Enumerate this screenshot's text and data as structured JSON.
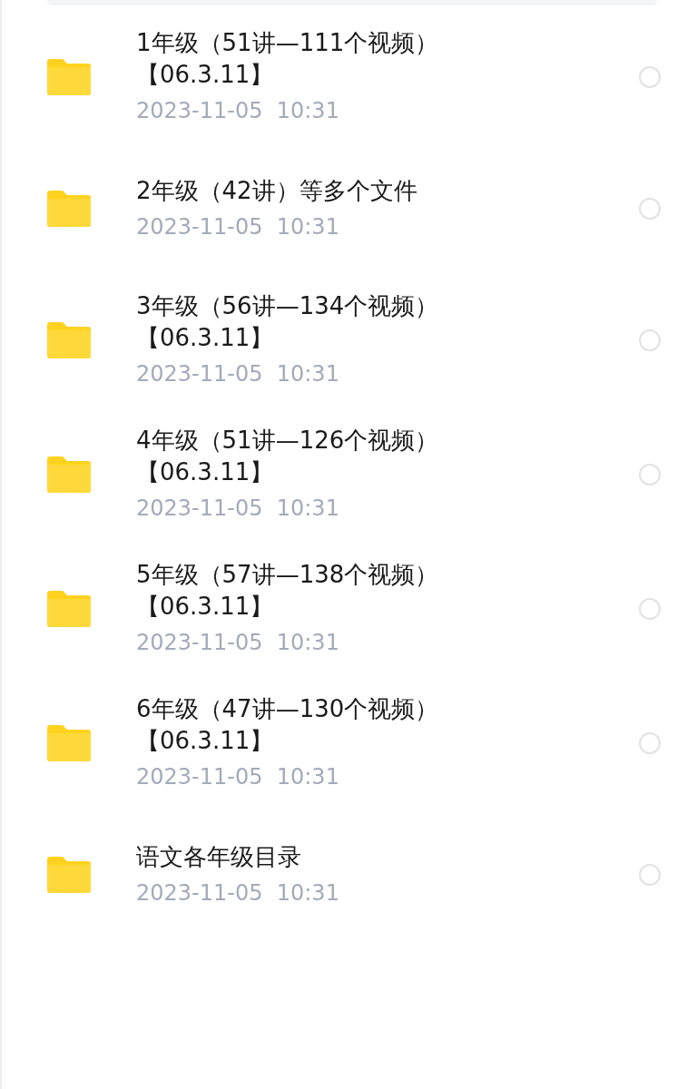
{
  "files": [
    {
      "name": "1年级（51讲—111个视频）【06.3.11】",
      "date": "2023-11-05  10:31",
      "selected": false
    },
    {
      "name": "2年级（42讲）等多个文件",
      "date": "2023-11-05  10:31",
      "selected": false
    },
    {
      "name": "3年级（56讲—134个视频）【06.3.11】",
      "date": "2023-11-05  10:31",
      "selected": false
    },
    {
      "name": "4年级（51讲—126个视频）【06.3.11】",
      "date": "2023-11-05  10:31",
      "selected": false
    },
    {
      "name": "5年级（57讲—138个视频）【06.3.11】",
      "date": "2023-11-05  10:31",
      "selected": false
    },
    {
      "name": "6年级（47讲—130个视频）【06.3.11】",
      "date": "2023-11-05  10:31",
      "selected": false
    },
    {
      "name": "语文各年级目录",
      "date": "2023-11-05  10:31",
      "selected": false
    }
  ]
}
